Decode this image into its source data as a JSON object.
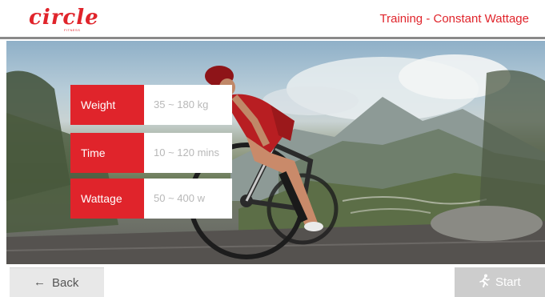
{
  "header": {
    "logo_text": "circle",
    "logo_subtext": "FITNESS",
    "title": "Training - Constant Wattage"
  },
  "hero": {
    "image_icon": "cyclist-photo"
  },
  "info": [
    {
      "label": "Weight",
      "value": "35 ~ 180 kg"
    },
    {
      "label": "Time",
      "value": "10 ~ 120 mins"
    },
    {
      "label": "Wattage",
      "value": "50 ~ 400 w"
    }
  ],
  "footer": {
    "back_icon": "arrow-left-icon",
    "back_label": "Back",
    "start_icon": "running-person-icon",
    "start_label": "Start"
  },
  "colors": {
    "accent": "#e0242b",
    "value_text": "#b8b8b8",
    "back_button_bg": "#e8e8e8",
    "start_button_bg": "#cdcdcd"
  }
}
